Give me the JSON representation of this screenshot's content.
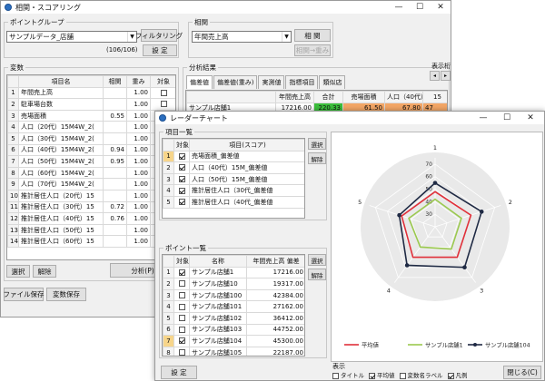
{
  "main_window": {
    "title": "相関・スコアリング",
    "controls": [
      "—",
      "☐",
      "✕"
    ]
  },
  "point_group": {
    "label": "ポイントグループ",
    "selected": "サンプルデータ_店舗",
    "filter_btn": "フィルタリング",
    "setting_btn": "設 定",
    "count": "(106/106)"
  },
  "correlation": {
    "label": "相関",
    "selected": "年間売上高",
    "calc_btn": "相 関",
    "weight_btn": "相関→重み"
  },
  "variables": {
    "label": "変数",
    "headers": [
      "項目名",
      "相関",
      "重み",
      "対象"
    ],
    "rows": [
      {
        "n": "1",
        "name": "年間売上高",
        "corr": "",
        "weight": "1.00",
        "chk": false
      },
      {
        "n": "2",
        "name": "駐車場台数",
        "corr": "",
        "weight": "1.00",
        "chk": false
      },
      {
        "n": "3",
        "name": "売場面積",
        "corr": "0.55",
        "weight": "1.00",
        "chk": true
      },
      {
        "n": "4",
        "name": "人口（20代）15M4W_2(",
        "corr": "",
        "weight": "1.00",
        "chk": false
      },
      {
        "n": "5",
        "name": "人口（30代）15M4W_2(",
        "corr": "",
        "weight": "1.00",
        "chk": false
      },
      {
        "n": "6",
        "name": "人口（40代）15M4W_2(",
        "corr": "0.94",
        "weight": "1.00",
        "chk": true
      },
      {
        "n": "7",
        "name": "人口（50代）15M4W_2(",
        "corr": "0.95",
        "weight": "1.00",
        "chk": true
      },
      {
        "n": "8",
        "name": "人口（60代）15M4W_2(",
        "corr": "",
        "weight": "1.00",
        "chk": false
      },
      {
        "n": "9",
        "name": "人口（70代）15M4W_2(",
        "corr": "",
        "weight": "1.00",
        "chk": false
      },
      {
        "n": "10",
        "name": "推計居住人口（20代）15",
        "corr": "",
        "weight": "1.00",
        "chk": false
      },
      {
        "n": "11",
        "name": "推計居住人口（30代）15",
        "corr": "0.72",
        "weight": "1.00",
        "chk": true
      },
      {
        "n": "12",
        "name": "推計居住人口（40代）15",
        "corr": "0.76",
        "weight": "1.00",
        "chk": true
      },
      {
        "n": "13",
        "name": "推計居住人口（50代）15",
        "corr": "",
        "weight": "1.00",
        "chk": false
      },
      {
        "n": "14",
        "name": "推計居住人口（60代）15",
        "corr": "",
        "weight": "1.00",
        "chk": false
      }
    ],
    "select_btn": "選択",
    "release_btn": "解除",
    "analyze_btn": "分析(P)"
  },
  "bottom_buttons": {
    "file_save": "ファイル保存",
    "var_save": "変数保存"
  },
  "analysis": {
    "label": "分析結果",
    "display_digits": "表示桁",
    "tabs": [
      "偏差値",
      "偏差値(重み)",
      "実測値",
      "指標項目",
      "類似店"
    ],
    "headers": [
      "年間売上高",
      "合計",
      "売場面積",
      "人口（40代）15M4W_2(",
      "15"
    ],
    "row": {
      "name": "サンプル店舗1",
      "v1": "17216.00",
      "v2": "220.33",
      "v3": "61.50",
      "v4": "67.80",
      "v5": "47"
    }
  },
  "radar_window": {
    "title": "レーダーチャート",
    "controls": [
      "—",
      "☐",
      "✕"
    ],
    "items": {
      "label": "項目一覧",
      "headers": [
        "対象",
        "項目(スコア)"
      ],
      "rows": [
        {
          "n": "1",
          "chk": true,
          "name": "売場面積_偏差値"
        },
        {
          "n": "2",
          "chk": true,
          "name": "人口（40代）15M_偏差値"
        },
        {
          "n": "3",
          "chk": true,
          "name": "人口（50代）15M_偏差値"
        },
        {
          "n": "4",
          "chk": true,
          "name": "推計居住人口（30代_偏差値"
        },
        {
          "n": "5",
          "chk": true,
          "name": "推計居住人口（40代_偏差値"
        }
      ],
      "select_btn": "選択",
      "release_btn": "解除"
    },
    "points": {
      "label": "ポイント一覧",
      "headers": [
        "対象",
        "名称",
        "年間売上高 偏差"
      ],
      "rows": [
        {
          "n": "1",
          "chk": true,
          "name": "サンプル店舗1",
          "val": "17216.00"
        },
        {
          "n": "2",
          "chk": false,
          "name": "サンプル店舗10",
          "val": "19317.00"
        },
        {
          "n": "3",
          "chk": false,
          "name": "サンプル店舗100",
          "val": "42384.00"
        },
        {
          "n": "4",
          "chk": false,
          "name": "サンプル店舗101",
          "val": "27162.00"
        },
        {
          "n": "5",
          "chk": false,
          "name": "サンプル店舗102",
          "val": "36412.00"
        },
        {
          "n": "6",
          "chk": false,
          "name": "サンプル店舗103",
          "val": "44752.00"
        },
        {
          "n": "7",
          "chk": true,
          "name": "サンプル店舗104",
          "val": "45300.00"
        },
        {
          "n": "8",
          "chk": false,
          "name": "サンプル店舗105",
          "val": "22187.00"
        }
      ],
      "select_btn": "選択",
      "release_btn": "解除"
    },
    "setting_btn": "設 定",
    "display": {
      "label": "表示",
      "options": [
        {
          "label": "タイトル",
          "chk": false
        },
        {
          "label": "平均値",
          "chk": true
        },
        {
          "label": "変数名ラベル",
          "chk": false
        },
        {
          "label": "凡例",
          "chk": true
        }
      ]
    },
    "close_btn": "閉じる(C)"
  },
  "chart_data": {
    "type": "radar",
    "axes": [
      "1",
      "2",
      "3",
      "4",
      "5"
    ],
    "ticks": [
      30,
      40,
      50,
      60,
      70
    ],
    "range": [
      20,
      75
    ],
    "series": [
      {
        "name": "平均値",
        "color": "#e0303a",
        "values": [
          48,
          50,
          50,
          50,
          48
        ]
      },
      {
        "name": "サンプル店舗1",
        "color": "#9bc94f",
        "values": [
          42,
          42,
          42,
          40,
          42
        ]
      },
      {
        "name": "サンプル店舗104",
        "color": "#1f2a44",
        "values": [
          55,
          59,
          60,
          58,
          50
        ]
      }
    ]
  }
}
